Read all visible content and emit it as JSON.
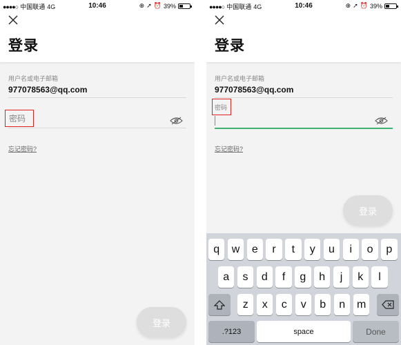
{
  "status_bar": {
    "signal": "●●●●○",
    "carrier": "中国联通",
    "network": "4G",
    "time": "10:46",
    "battery_percent": "39%",
    "battery_level": 0.39
  },
  "screen": {
    "title": "登录",
    "username_label": "用户名或电子邮箱",
    "username_value": "977078563@qq.com",
    "password_placeholder": "密码",
    "password_label": "密码",
    "forgot_label": "忘记密码?",
    "login_label": "登录"
  },
  "keyboard": {
    "row1": [
      "q",
      "w",
      "e",
      "r",
      "t",
      "y",
      "u",
      "i",
      "o",
      "p"
    ],
    "row2": [
      "a",
      "s",
      "d",
      "f",
      "g",
      "h",
      "j",
      "k",
      "l"
    ],
    "row3": [
      "z",
      "x",
      "c",
      "v",
      "b",
      "n",
      "m"
    ],
    "numbers_label": ".?123",
    "space_label": "space",
    "done_label": "Done"
  },
  "colors": {
    "focus_underline": "#3cb371",
    "highlight_box": "#e02020",
    "button_disabled": "#dedede"
  }
}
